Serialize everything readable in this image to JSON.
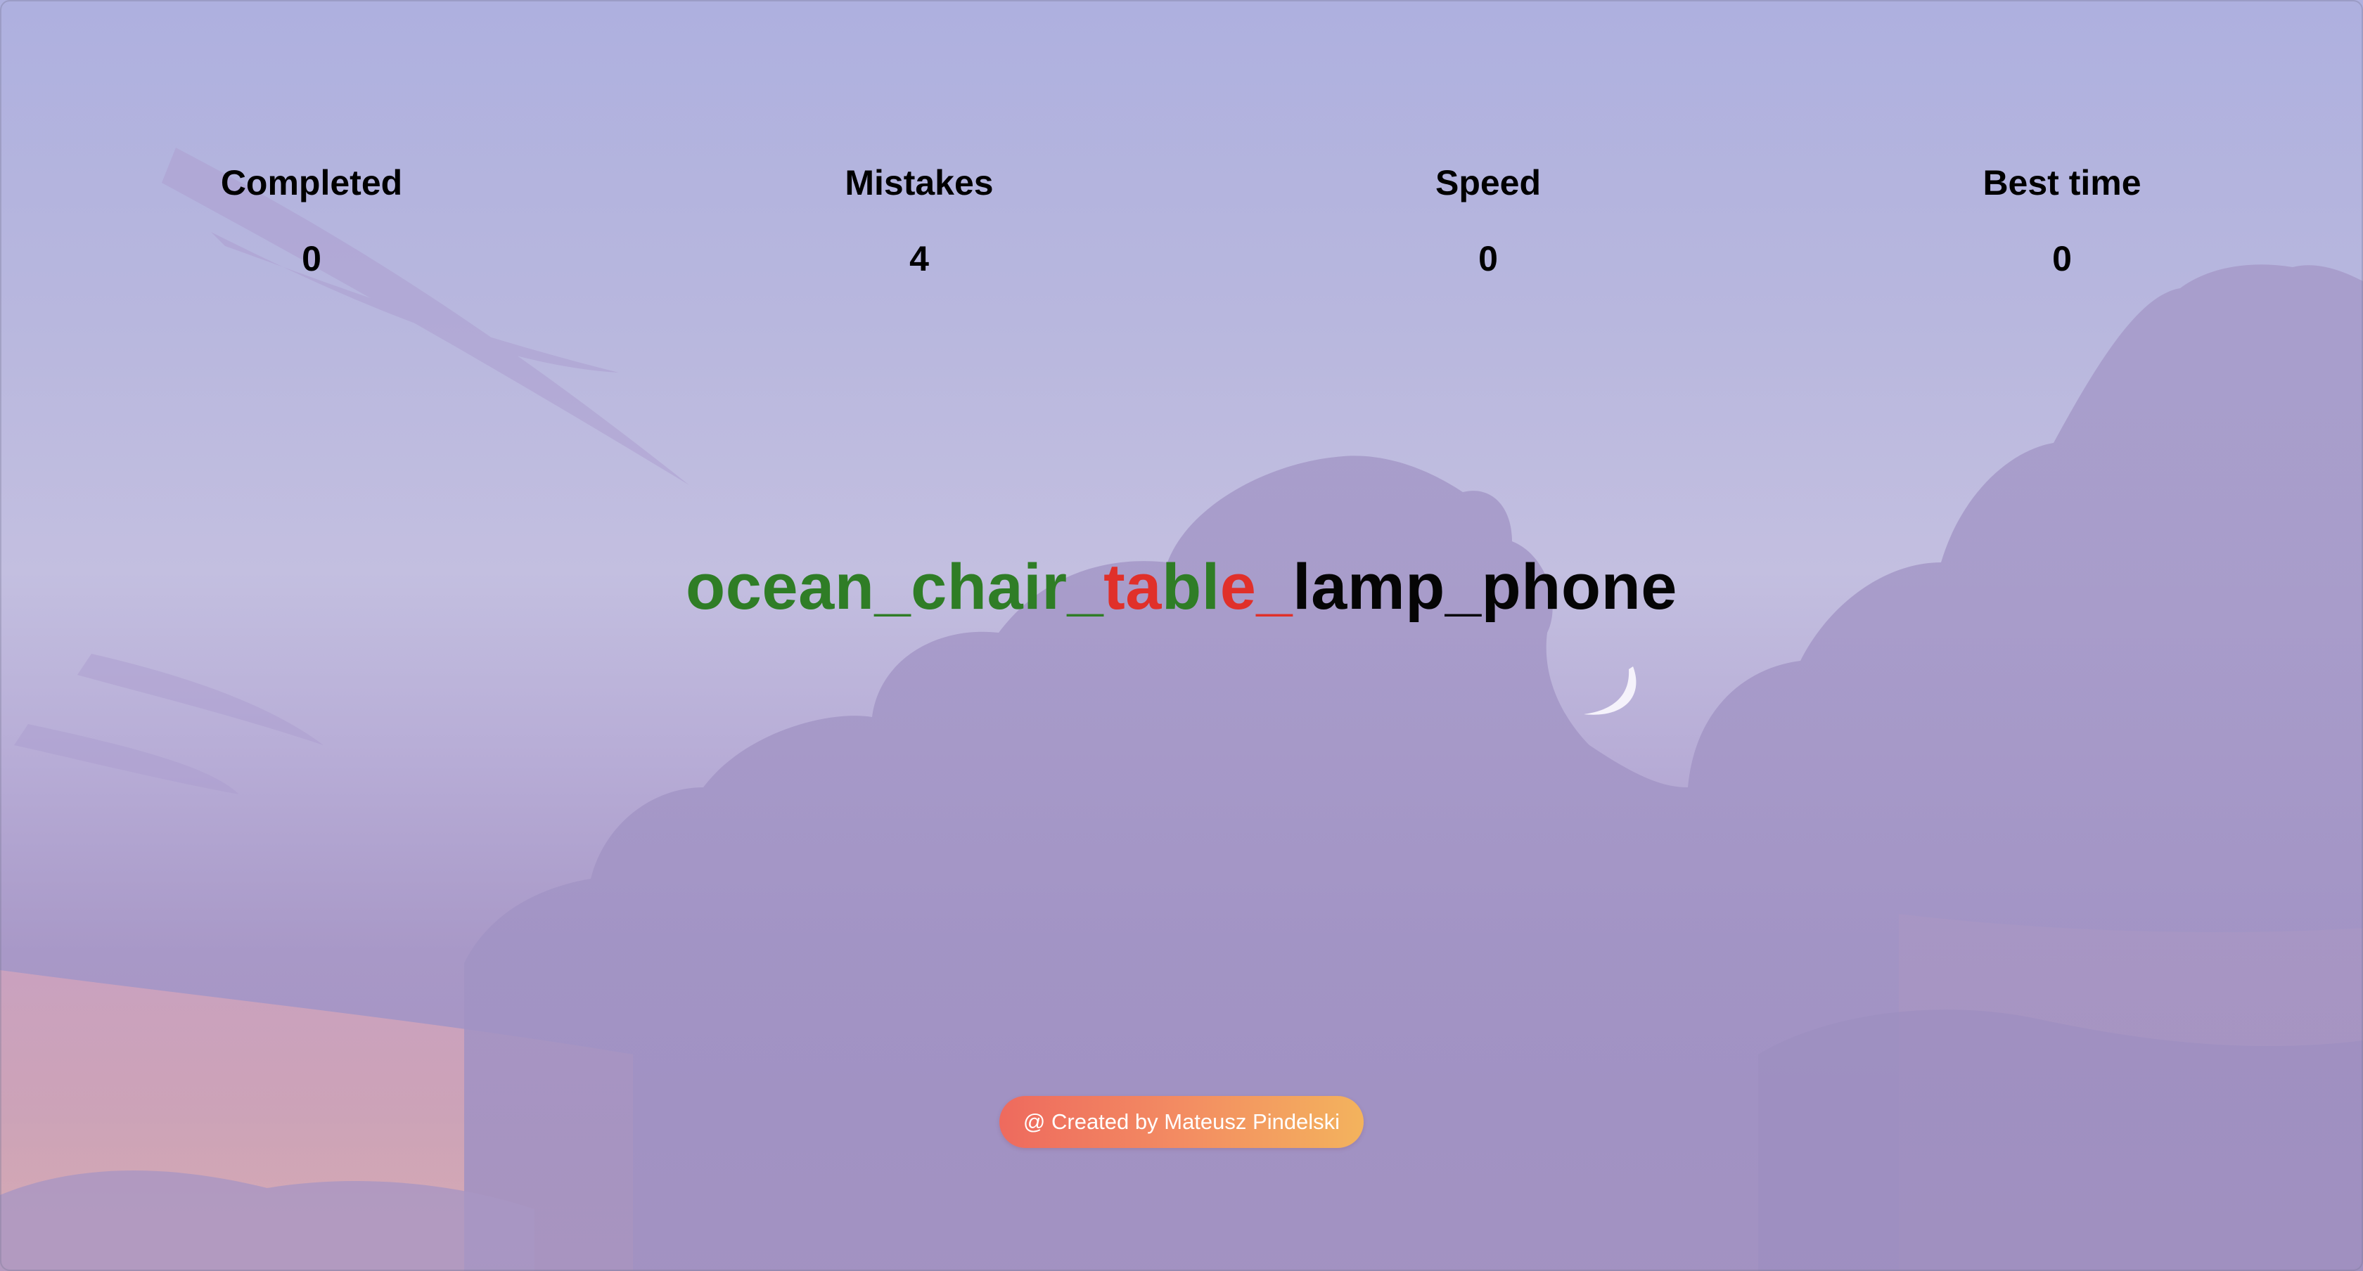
{
  "stats": {
    "completed": {
      "label": "Completed",
      "value": "0"
    },
    "mistakes": {
      "label": "Mistakes",
      "value": "4"
    },
    "speed": {
      "label": "Speed",
      "value": "0"
    },
    "best_time": {
      "label": "Best time",
      "value": "0"
    }
  },
  "typing": {
    "segments": [
      {
        "text": "ocean_chair_",
        "state": "correct"
      },
      {
        "text": "ta",
        "state": "wrong"
      },
      {
        "text": "bl",
        "state": "correct"
      },
      {
        "text": "e_",
        "state": "wrong"
      },
      {
        "text": "lamp_phone",
        "state": "pending"
      }
    ]
  },
  "footer": {
    "credit": "@ Created by Mateusz Pindelski"
  },
  "colors": {
    "correct": "#2f7d26",
    "wrong": "#e0302a",
    "pending": "#050505",
    "credit_gradient_start": "#ee6a5e",
    "credit_gradient_end": "#f3b35d"
  },
  "icons": {
    "background": "sky-clouds-moon-illustration"
  }
}
